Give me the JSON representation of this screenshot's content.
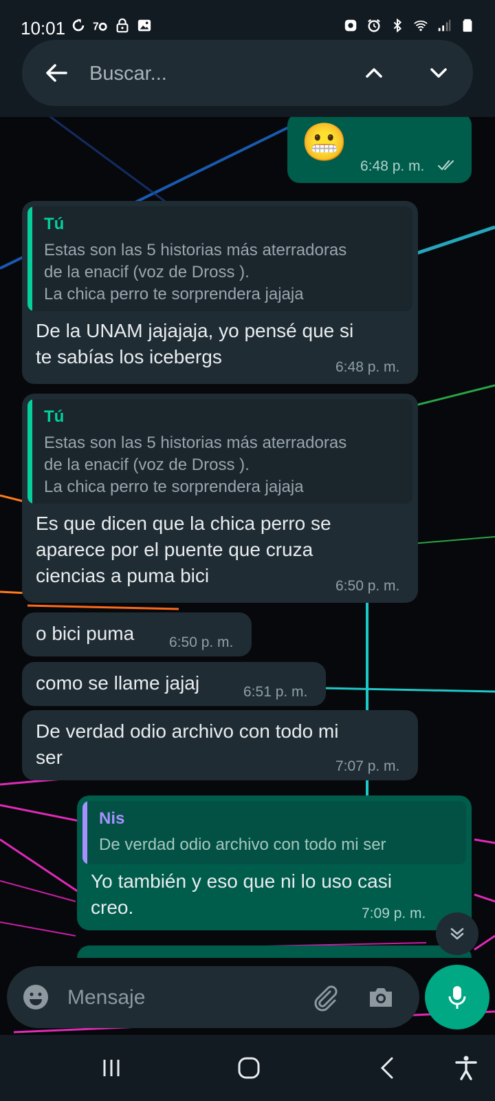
{
  "status_bar": {
    "time": "10:01",
    "left_icons": [
      "sync-icon",
      "seventy-icon",
      "lock-icon",
      "gallery-icon"
    ],
    "right_icons": [
      "vpn-icon",
      "alarm-icon",
      "bluetooth-icon",
      "wifi-icon",
      "signal-icon",
      "battery-icon"
    ]
  },
  "search": {
    "placeholder": "Buscar..."
  },
  "messages": [
    {
      "type": "out",
      "emoji": "😬",
      "time": "6:48 p. m."
    },
    {
      "type": "in",
      "reply_author": "Tú",
      "reply_text": "Estas son las 5 historias más aterradoras\nde la enacif (voz de Dross ).\n La chica perro te sorprendera jajaja",
      "text": "De la UNAM jajajaja, yo pensé que si\nte sabías los icebergs",
      "time": "6:48 p. m."
    },
    {
      "type": "in",
      "reply_author": "Tú",
      "reply_text": "Estas son las 5 historias más aterradoras\nde la enacif (voz de Dross ).\n La chica perro te sorprendera jajaja",
      "text": "Es que dicen que la chica perro se\naparece por el puente que cruza\nciencias a puma bici",
      "time": "6:50 p. m."
    },
    {
      "type": "in",
      "text": "o bici puma",
      "time": "6:50 p. m."
    },
    {
      "type": "in",
      "text": "como se llame jajaj",
      "time": "6:51 p. m."
    },
    {
      "type": "in",
      "text": "De verdad odio archivo con todo mi\nser",
      "time": "7:07 p. m."
    },
    {
      "type": "out",
      "reply_author": "Nis",
      "reply_text": "De verdad odio archivo con todo mi ser",
      "text": "Yo también y eso que ni lo uso casi\ncreo.",
      "time": "7:09 p. m."
    }
  ],
  "composer": {
    "placeholder": "Mensaje"
  },
  "colors": {
    "accent": "#00a884",
    "incoming_bubble": "#1f2c34",
    "outgoing_bubble": "#005c4b",
    "quote_tu": "#06cf9c",
    "quote_nis": "#a791ff"
  }
}
